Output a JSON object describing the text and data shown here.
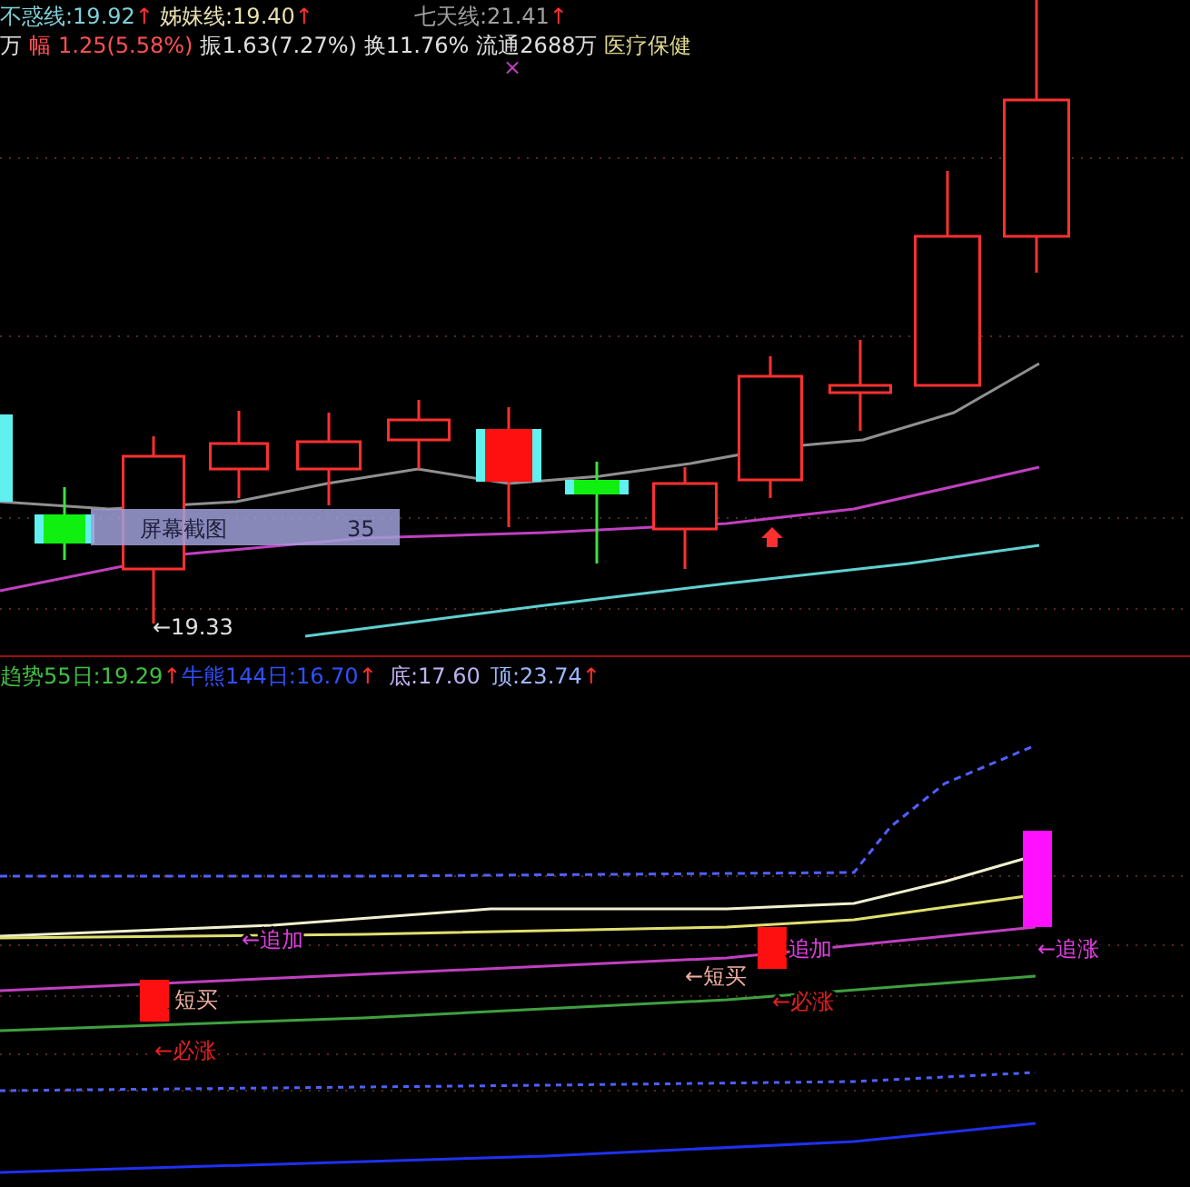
{
  "price_panel": {
    "legend": [
      {
        "label": "不惑线:",
        "value": "19.92",
        "arrow": "↑",
        "color": "#7fd0d8"
      },
      {
        "label": "姊妹线:",
        "value": "19.40",
        "arrow": "↑",
        "color": "#e8e0b0"
      },
      {
        "label": "七天线:",
        "value": "21.41",
        "arrow": "↑",
        "color": "#a0a0a0"
      }
    ],
    "stats": [
      {
        "text": "万",
        "color": "#e0e0e0"
      },
      {
        "text": "幅",
        "color": "#ff5050"
      },
      {
        "text": "1.25(5.58%)",
        "color": "#ff5050"
      },
      {
        "text": "振1.63(7.27%)",
        "color": "#e0e0e0"
      },
      {
        "text": "换11.76%",
        "color": "#e0e0e0"
      },
      {
        "text": "流通2688万",
        "color": "#e0e0e0"
      },
      {
        "text": "医疗保健",
        "color": "#e0d890"
      }
    ],
    "marker": "×",
    "tooltip": {
      "label": "屏幕截图",
      "value": "35"
    },
    "low_label": "←19.33"
  },
  "indicator_panel": {
    "legend": [
      {
        "label": "趋势55日:",
        "value": "19.29",
        "arrow": "↑",
        "color": "#40c040"
      },
      {
        "label": "牛熊144日:",
        "value": "16.70",
        "arrow": "↑",
        "color": "#3050ff"
      },
      {
        "label": "底:",
        "value": "17.60",
        "color": "#c0b0f0"
      },
      {
        "label": "顶:",
        "value": "23.74",
        "arrow": "↑",
        "color": "#a0b8ff"
      }
    ],
    "signals": [
      {
        "text": "←追加",
        "color": "#e040e0"
      },
      {
        "text": "短买",
        "color": "#f0b0a0"
      },
      {
        "text": "←必涨",
        "color": "#e02020"
      },
      {
        "text": "追加",
        "color": "#e040e0"
      },
      {
        "text": "←短买",
        "color": "#f0b0a0"
      },
      {
        "text": "←必涨",
        "color": "#e02020"
      },
      {
        "text": "←追涨",
        "color": "#e040e0"
      }
    ]
  }
}
